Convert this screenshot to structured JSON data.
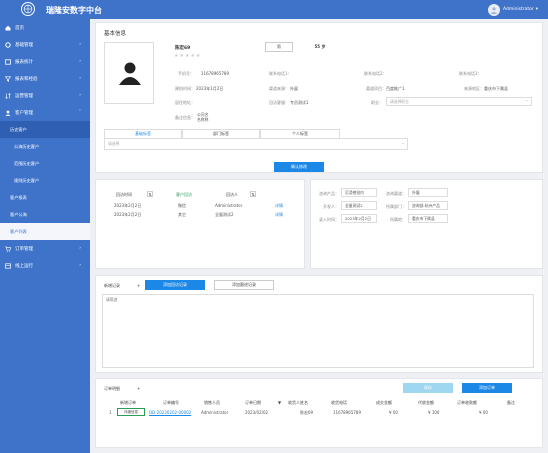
{
  "header": {
    "app_title": "瑞隆安数字中台",
    "user": "Administrator"
  },
  "sidebar": {
    "items": [
      {
        "label": "首页"
      },
      {
        "label": "基础管理"
      },
      {
        "label": "报表统计"
      },
      {
        "label": "报表和经验"
      },
      {
        "label": "运营管理"
      },
      {
        "label": "客户管理"
      },
      {
        "label": "订单管理"
      },
      {
        "label": "线上运行"
      }
    ],
    "sub": [
      {
        "label": "历史客户"
      },
      {
        "label": "公海历史客户"
      },
      {
        "label": "范围历史客户"
      },
      {
        "label": "规则历史客户"
      },
      {
        "label": "客户报表"
      },
      {
        "label": "客户公海"
      },
      {
        "label": "客户列表"
      }
    ]
  },
  "basic_info": {
    "title": "基本信息",
    "name": "陈宏69",
    "gender_badge": "男",
    "level_badge": "55 岁",
    "fields": {
      "phone_label": "手机号：",
      "phone": "11678965789",
      "contact1_label": "联系电话1：",
      "contact2_label": "联系电话2：",
      "contact3_label": "联系电话3：",
      "created_label": "建档时间：",
      "created": "2023年1月2日",
      "source_label": "渠道来源：",
      "source": "外展",
      "channel_label": "渠道项目：",
      "channel": "百度推广1",
      "province_label": "来源地区：",
      "province": "重庆市下属县",
      "addr_label": "居住地址：",
      "visit_label": "回访客服：",
      "visit": "专员测试1",
      "unit_label": "职业：",
      "unit_placeholder": "请选择职业",
      "notes_label": "备注信息：",
      "notes": [
        "公司名",
        "名称称"
      ]
    },
    "tabs": [
      "基础标签",
      "部门标签",
      "个人标签"
    ],
    "tag_placeholder": "请选择",
    "confirm_button": "确认修改"
  },
  "visit_card": {
    "headers": [
      "回访时间",
      "客户回访",
      "回访人"
    ],
    "rows": [
      {
        "time": "2023年2月2日",
        "type": "微信",
        "user": "Administrator",
        "action": "详情"
      },
      {
        "time": "2023年2月2日",
        "type": "其它",
        "user": "全量测试2",
        "action": "详情"
      }
    ]
  },
  "right_card": {
    "r1": {
      "l1": "咨询产品：",
      "v1": "沉浸感觉内",
      "l2": "咨询渠道：",
      "v2": "外展"
    },
    "r2": {
      "l1": "开发人：",
      "v1": "全量测试2",
      "l2": "所属部门：",
      "v2": "咨询部-杭州产品"
    },
    "r3": {
      "l1": "录入时间：",
      "v1": "2023年2月2日",
      "l2": "所属地：",
      "v2": "重庆市下属县"
    }
  },
  "record_card": {
    "label": "新增记录",
    "button1": "添加回访记录",
    "button2": "添加跟进记录",
    "textarea_placeholder": "请简述"
  },
  "order_card": {
    "label": "订单明细",
    "plus": "+",
    "light_button": "保存",
    "add_button": "添加订单",
    "headers": [
      "新增订单",
      "订单编号",
      "销售人员",
      "订单日期",
      "收货人姓名",
      "收货电话",
      "成交金额",
      "代收金额",
      "订单收款额",
      "备注"
    ],
    "rows": [
      {
        "idx": "1",
        "op": "详细信息",
        "order_no": "OD-20230202-00002",
        "sales": "Administrator",
        "date": "2023/02/02",
        "receiver": "陈宏69",
        "phone": "11678965789",
        "deal": "¥ 00",
        "collect": "¥ 100",
        "received": "¥ 00",
        "remark": ""
      }
    ]
  }
}
